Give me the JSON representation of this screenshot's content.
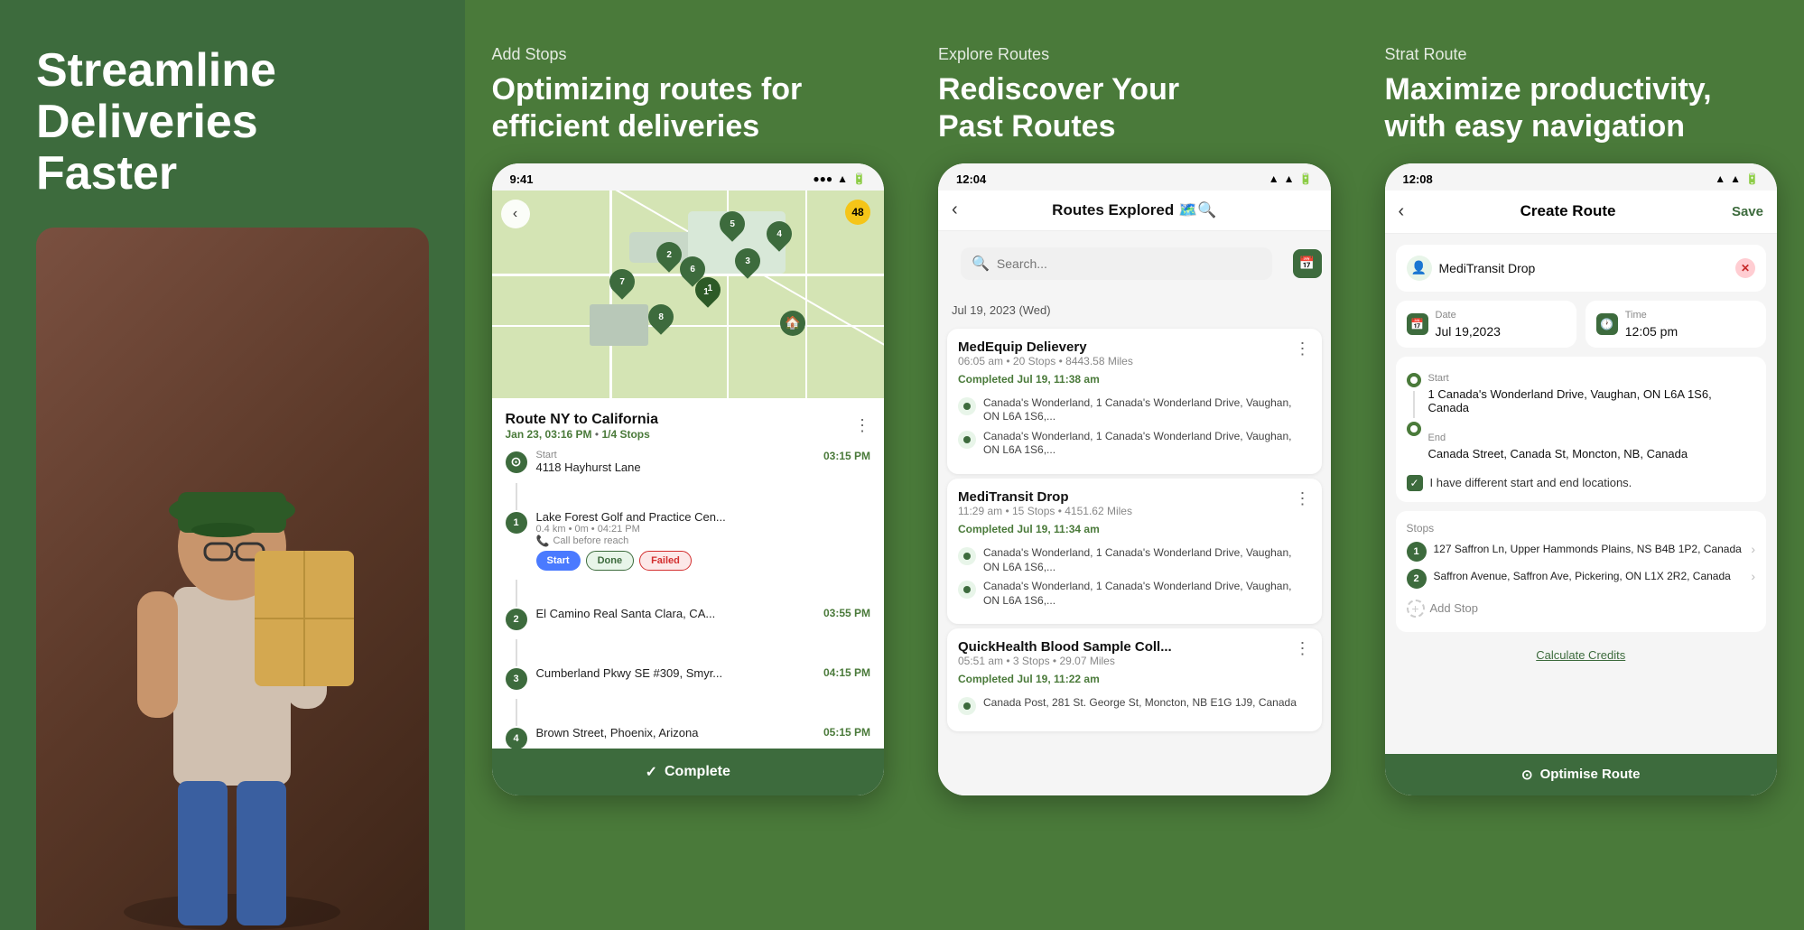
{
  "panel1": {
    "headline": "Streamline\nDeliveries\nFaster"
  },
  "panel2": {
    "label": "Add Stops",
    "title": "Optimizing routes for efficient deliveries",
    "status_time": "9:41",
    "route_name": "Route NY to California",
    "route_meta": "Jan 23, 03:16 PM",
    "route_stops": "1/4 Stops",
    "start_address": "4118 Hayhurst Lane",
    "start_time": "03:15 PM",
    "stop1_name": "Lake Forest Golf and Practice Cen...",
    "stop1_meta": "0.4 km • 0m • 04:21 PM",
    "stop1_sub": "Call before reach",
    "stop1_time": "",
    "stop2_name": "El Camino Real Santa Clara, CA...",
    "stop2_time": "03:55 PM",
    "stop3_name": "Cumberland Pkwy SE #309, Smyr...",
    "stop3_time": "04:15 PM",
    "stop4_name": "Brown Street, Phoenix, Arizona",
    "stop4_time": "05:15 PM",
    "btn_start": "Start",
    "btn_done": "Done",
    "btn_failed": "Failed",
    "btn_complete": "Complete"
  },
  "panel3": {
    "label": "Explore Routes",
    "title": "Rediscover Your\nPast Routes",
    "status_time": "12:04",
    "screen_title": "Routes Explored 🗺️🔍",
    "search_placeholder": "Search...",
    "date_header": "Jul 19, 2023 (Wed)",
    "card1_name": "MedEquip Delievery",
    "card1_meta": "06:05 am • 20 Stops • 8443.58 Miles",
    "card1_completed": "Completed Jul 19, 11:38 am",
    "card1_loc1": "Canada's Wonderland, 1 Canada's Wonderland Drive, Vaughan, ON L6A 1S6,...",
    "card1_loc2": "Canada's Wonderland, 1 Canada's Wonderland Drive, Vaughan, ON L6A 1S6,...",
    "card2_name": "MediTransit Drop",
    "card2_meta": "11:29 am • 15 Stops • 4151.62 Miles",
    "card2_completed": "Completed Jul 19, 11:34 am",
    "card2_loc1": "Canada's Wonderland, 1 Canada's Wonderland Drive, Vaughan, ON L6A 1S6,...",
    "card2_loc2": "Canada's Wonderland, 1 Canada's Wonderland Drive, Vaughan, ON L6A 1S6,...",
    "card3_name": "QuickHealth Blood Sample Coll...",
    "card3_meta": "05:51 am • 3 Stops • 29.07 Miles",
    "card3_completed": "Completed Jul 19, 11:22 am",
    "card3_loc1": "Canada Post, 281 St. George St, Moncton, NB E1G 1J9, Canada"
  },
  "panel4": {
    "label": "Strat Route",
    "title": "Maximize productivity,\nwith easy navigation",
    "status_time": "12:08",
    "screen_title": "Create Route",
    "btn_save": "Save",
    "route_name": "MediTransit Drop",
    "date_label": "Date",
    "date_value": "Jul 19,2023",
    "time_label": "Time",
    "time_value": "12:05 pm",
    "start_label": "Start",
    "start_value": "1 Canada's Wonderland Drive, Vaughan, ON L6A 1S6, Canada",
    "end_label": "End",
    "end_value": "Canada Street, Canada St, Moncton, NB, Canada",
    "checkbox_label": "I have different start and end locations.",
    "stops_label": "Stops",
    "stop1": "127 Saffron Ln, Upper Hammonds Plains, NS B4B 1P2, Canada",
    "stop2": "Saffron Avenue, Saffron Ave, Pickering, ON L1X 2R2, Canada",
    "add_stop": "Add Stop",
    "calc_credits": "Calculate Credits",
    "optimise_btn": "Optimise Route"
  }
}
